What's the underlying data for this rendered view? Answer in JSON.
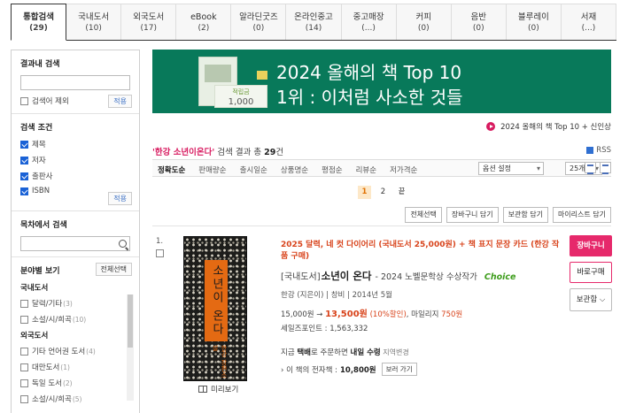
{
  "tabs": [
    {
      "label": "통합검색",
      "count": "(29)"
    },
    {
      "label": "국내도서",
      "count": "(10)"
    },
    {
      "label": "외국도서",
      "count": "(17)"
    },
    {
      "label": "eBook",
      "count": "(2)"
    },
    {
      "label": "알라딘굿즈",
      "count": "(0)"
    },
    {
      "label": "온라인중고",
      "count": "(14)"
    },
    {
      "label": "중고매장",
      "count": "(...)"
    },
    {
      "label": "커피",
      "count": "(0)"
    },
    {
      "label": "음반",
      "count": "(0)"
    },
    {
      "label": "블루레이",
      "count": "(0)"
    },
    {
      "label": "서재",
      "count": "(...)"
    }
  ],
  "sidebar": {
    "inner_search": {
      "title": "결과내 검색",
      "exclude_label": "검색어 제외",
      "apply": "적용"
    },
    "conditions": {
      "title": "검색 조건",
      "items": [
        "제목",
        "저자",
        "출판사",
        "ISBN"
      ],
      "apply": "적용"
    },
    "toc_search": {
      "title": "목차에서 검색"
    },
    "category": {
      "title": "분야별 보기",
      "select_all": "전체선택",
      "groups": [
        {
          "name": "국내도서",
          "items": [
            {
              "label": "달력/기타",
              "n": "(3)"
            },
            {
              "label": "소설/시/희곡",
              "n": "(10)"
            }
          ]
        },
        {
          "name": "외국도서",
          "items": [
            {
              "label": "기타 언어권 도서",
              "n": "(4)"
            },
            {
              "label": "대만도서",
              "n": "(1)"
            },
            {
              "label": "독일 도서",
              "n": "(2)"
            },
            {
              "label": "소설/시/희곡",
              "n": "(5)"
            }
          ]
        }
      ]
    }
  },
  "banner": {
    "line1": "2024 올해의 책 Top 10",
    "line2": "1위 : 이처럼 사소한 것들",
    "point_label": "적립금",
    "point_value": "1,000",
    "link": "2024 올해의 책 Top 10 + 신인상"
  },
  "results": {
    "query": "'한강 소년이온다'",
    "label": " 검색 결과 총 ",
    "count": "29",
    "unit": "건",
    "rss": "RSS"
  },
  "sort": {
    "options": [
      "정확도순",
      "판매량순",
      "출시일순",
      "상품명순",
      "평점순",
      "리뷰순",
      "저가격순"
    ],
    "option_setting": "옵션 설정",
    "per_page": "25개"
  },
  "pager": [
    "1",
    "2",
    "끝"
  ],
  "actions": [
    "전체선택",
    "장바구니 담기",
    "보관함 담기",
    "마이리스트 담기"
  ],
  "product": {
    "index": "1.",
    "promo": "2025 달력, 네 컷 다이어리 (국내도서 25,000원) + 책 표지 문장 카드 (한강 작품 구매)",
    "kind": "[국내도서]",
    "title": "소년이 온다",
    "subtitle": " - 2024 노벨문학상 수상작가",
    "choice": "Choice",
    "meta": "한강 (지은이) | 창비 | 2014년 5월",
    "list_price": "15,000원 → ",
    "sale_price": "13,500원",
    "discount": " (10%할인)",
    "mileage_label": ", 마일리지 ",
    "mileage": "750원",
    "sales_point": "세일즈포인트 : 1,563,332",
    "ship_a": "지금 ",
    "ship_b": "택배",
    "ship_c": "로 주문하면 ",
    "ship_d": "내일 수령",
    "ship_e": " 지역변경",
    "ebook_label": "› 이 책의 전자책 : ",
    "ebook_price": "10,800원",
    "ebook_btn": "보러 가기",
    "preview": "미리보기",
    "cover_title": "소년이 온다",
    "cover_author": "한강 장편소설",
    "cart": "장바구니",
    "buy": "바로구매",
    "keep": "보관함"
  }
}
